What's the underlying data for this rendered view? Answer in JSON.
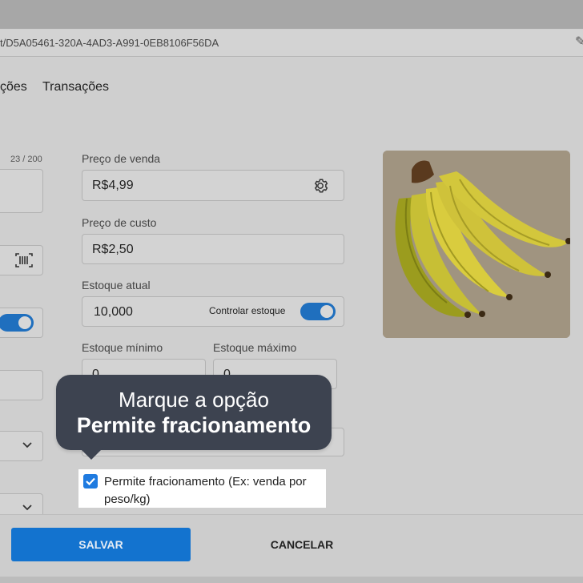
{
  "browser": {
    "url": "t/D5A05461-320A-4AD3-A991-0EB8106F56DA"
  },
  "tabs": [
    {
      "label": "ções"
    },
    {
      "label": "Transações"
    }
  ],
  "left_column": {
    "name_counter": "23 / 200"
  },
  "price": {
    "label": "Preço de venda",
    "value": "R$4,99"
  },
  "cost": {
    "label": "Preço de custo",
    "value": "R$2,50"
  },
  "stock": {
    "label": "Estoque atual",
    "value": "10,000",
    "control_label": "Controlar estoque",
    "control_enabled": true
  },
  "min_stock": {
    "label": "Estoque mínimo",
    "value": "0"
  },
  "max_stock": {
    "label": "Estoque máximo",
    "value": "0"
  },
  "tooltip": {
    "line1": "Marque a opção",
    "line2": "Permite fracionamento"
  },
  "fraction": {
    "label": "Permite fracionamento (Ex: venda por peso/kg)",
    "checked": true
  },
  "footer": {
    "save_label": "SALVAR",
    "cancel_label": "CANCELAR"
  },
  "colors": {
    "accent": "#1373cf",
    "tooltip_bg": "#3d4350"
  },
  "product_image": {
    "icon": "banana-bunch-photo"
  }
}
